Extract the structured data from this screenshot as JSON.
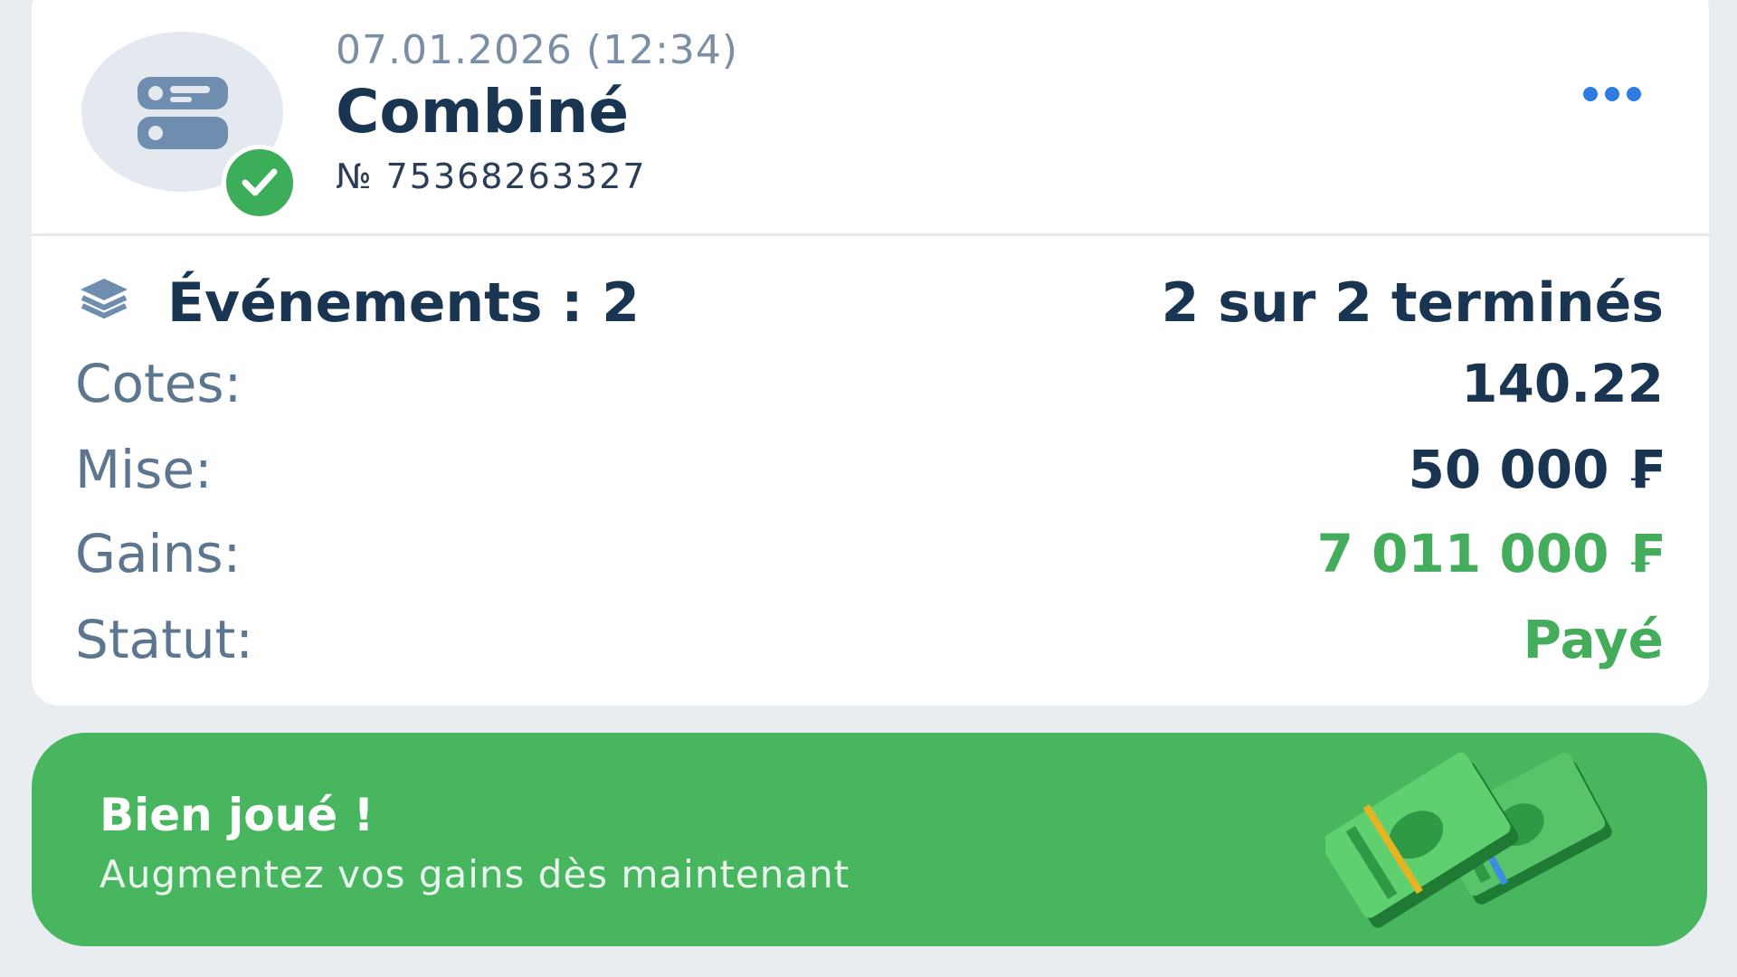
{
  "bet": {
    "date": "07.01.2026 (12:34)",
    "type": "Combiné",
    "number": "№ 75368263327",
    "status_icon": "check-icon",
    "avatar_icon": "coupon-icon"
  },
  "summary": {
    "events_label": "Événements : 2",
    "events_done": "2  sur 2 terminés",
    "rows": [
      {
        "label": "Cotes:",
        "value": "140.22"
      },
      {
        "label": "Mise:",
        "value": "50 000 ₣"
      },
      {
        "label": "Gains:",
        "value": "7 011 000 ₣"
      },
      {
        "label": "Statut:",
        "value": "Payé"
      }
    ]
  },
  "banner": {
    "title": "Bien joué !",
    "subtitle": "Augmentez vos gains dès maintenant"
  },
  "colors": {
    "accent_green": "#47b65f",
    "dark_text": "#1a3552",
    "label_text": "#5d7690",
    "link_blue": "#2e7ae0"
  }
}
